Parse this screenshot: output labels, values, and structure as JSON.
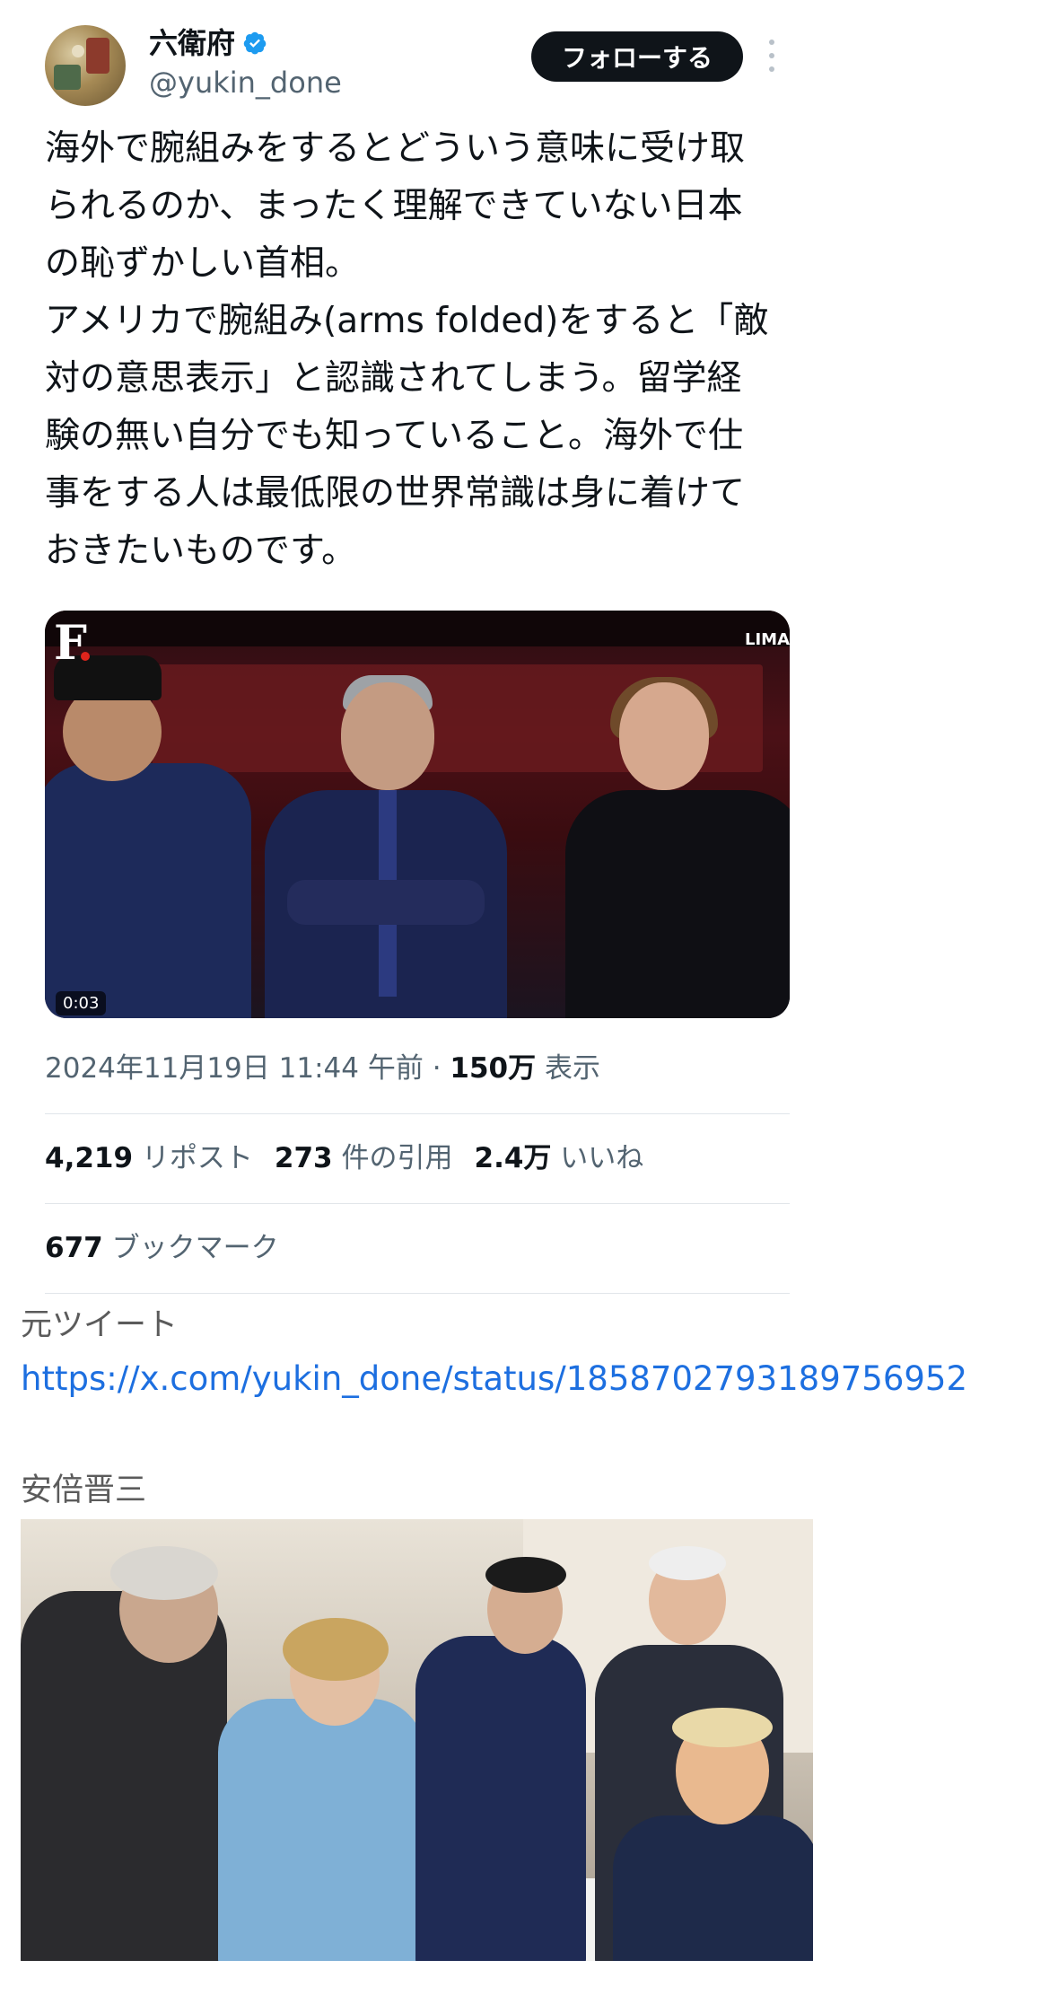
{
  "tweet": {
    "author_name": "六衛府",
    "author_handle": "@yukin_done",
    "follow_label": "フォローする",
    "text": "海外で腕組みをするとどういう意味に受け取\nられるのか、まったく理解できていない日本\nの恥ずかしい首相。\nアメリカで腕組み(arms folded)をすると「敵\n対の意思表示」と認識されてしまう。留学経\n験の無い自分でも知っていること。海外で仕\n事をする人は最低限の世界常識は身に着けて\nおきたいものです。",
    "video": {
      "logo": "F",
      "corner_text": "LIMA",
      "duration": "0:03"
    },
    "timestamp": "2024年11月19日 11:44 午前",
    "separator": " · ",
    "views_count": "150万",
    "views_label": "表示",
    "stats": {
      "reposts_count": "4,219",
      "reposts_label": "リポスト",
      "quotes_count": "273",
      "quotes_label": "件の引用",
      "likes_count": "2.4万",
      "likes_label": "いいね",
      "bookmarks_count": "677",
      "bookmarks_label": "ブックマーク"
    }
  },
  "source_label": "元ツイート",
  "source_url": "https://x.com/yukin_done/status/1858702793189756952",
  "photo_caption": "安倍晋三",
  "colors": {
    "text": "#0f1419",
    "secondary": "#536471",
    "link": "#1d6fe0",
    "verified": "#1d9bf0",
    "follow_bg": "#0f1419"
  },
  "icons": {
    "verified": "verified-badge-icon",
    "more": "more-vertical-icon"
  }
}
